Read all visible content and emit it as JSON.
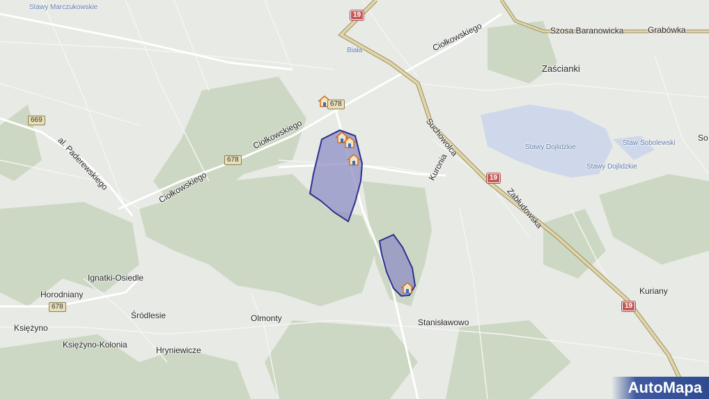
{
  "map": {
    "place_labels": [
      {
        "id": "stawy-marczukowskie",
        "text": "Stawy Marczukowskie"
      },
      {
        "id": "biala",
        "text": "Biała"
      },
      {
        "id": "szosa-baranowicka",
        "text": "Szosa Baranowicka"
      },
      {
        "id": "grabowka",
        "text": "Grabówka"
      },
      {
        "id": "zascianki",
        "text": "Zaścianki"
      },
      {
        "id": "stawy-dojlidzkie-1",
        "text": "Stawy Dojlidzkie"
      },
      {
        "id": "staw-sobolewski",
        "text": "Staw Sobolewski"
      },
      {
        "id": "stawy-dojlidzkie-2",
        "text": "Stawy Dojlidzkie"
      },
      {
        "id": "so",
        "text": "So"
      },
      {
        "id": "kurany",
        "text": "Kuriany"
      },
      {
        "id": "ignatki",
        "text": "Ignatki-Osiedle"
      },
      {
        "id": "horodniany",
        "text": "Horodniany"
      },
      {
        "id": "ksiezyno",
        "text": "Księżyno"
      },
      {
        "id": "ksiezyno-kolonia",
        "text": "Księżyno-Kolonia"
      },
      {
        "id": "srodlesie",
        "text": "Śródlesie"
      },
      {
        "id": "hryniewicze",
        "text": "Hryniewicze"
      },
      {
        "id": "olmonty",
        "text": "Olmonty"
      },
      {
        "id": "stanislawowo",
        "text": "Stanisławowo"
      }
    ],
    "street_labels": [
      {
        "id": "ciolkowskiego-1",
        "text": "Ciołkowskiego"
      },
      {
        "id": "ciolkowskiego-2",
        "text": "Ciołkowskiego"
      },
      {
        "id": "ciolkowskiego-3",
        "text": "Ciołkowskiego"
      },
      {
        "id": "paderewskiego",
        "text": "al. Paderewskiego"
      },
      {
        "id": "suchowolca",
        "text": "Suchowolca"
      },
      {
        "id": "kuronia",
        "text": "Kuronia"
      },
      {
        "id": "zabludowska",
        "text": "Zabłudowska"
      }
    ],
    "road_shields": [
      {
        "id": "s19-top",
        "text": "19",
        "kind": "national"
      },
      {
        "id": "s19-mid",
        "text": "19",
        "kind": "national"
      },
      {
        "id": "s19-bot",
        "text": "19",
        "kind": "national"
      },
      {
        "id": "s678-top",
        "text": "678",
        "kind": "regional"
      },
      {
        "id": "s678-mid",
        "text": "678",
        "kind": "regional"
      },
      {
        "id": "s678-bot",
        "text": "678",
        "kind": "regional"
      },
      {
        "id": "s669",
        "text": "669",
        "kind": "regional"
      }
    ],
    "markers": [
      "house-marker",
      "house-marker",
      "house-marker",
      "house-marker",
      "house-marker"
    ],
    "colors": {
      "highlight_fill": "#8f8fc4",
      "highlight_stroke": "#2b2f8c",
      "forest": "#cdd8c4",
      "water": "#cfd8ea",
      "national_road": "#c9b98a"
    },
    "logo": "AutoMapa"
  }
}
